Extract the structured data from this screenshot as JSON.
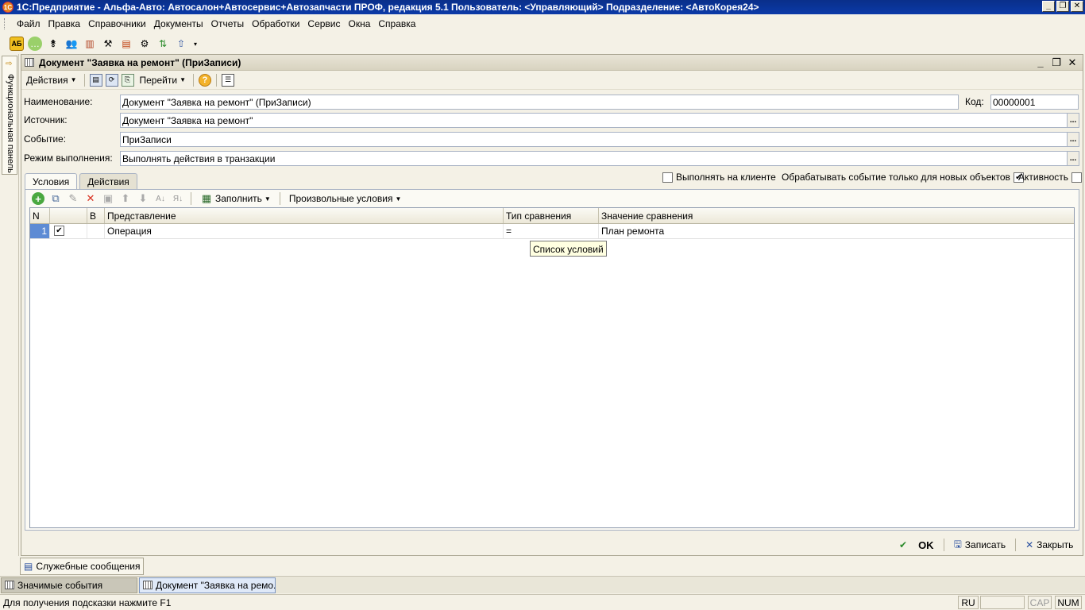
{
  "window": {
    "title": "1С:Предприятие - Альфа-Авто: Автосалон+Автосервис+Автозапчасти ПРОФ, редакция 5.1    Пользователь: <Управляющий>    Подразделение: <АвтоКорея24>",
    "app_icon": "1С"
  },
  "menu": [
    "Файл",
    "Правка",
    "Справочники",
    "Документы",
    "Отчеты",
    "Обработки",
    "Сервис",
    "Окна",
    "Справка"
  ],
  "side_panel": {
    "label": "Функциональная панель"
  },
  "document": {
    "title": "Документ \"Заявка на ремонт\" (ПриЗаписи)",
    "toolbar": {
      "actions": "Действия",
      "goto": "Перейти",
      "help": "?"
    },
    "fields": {
      "name_label": "Наименование:",
      "name_value": "Документ \"Заявка на ремонт\" (ПриЗаписи)",
      "code_label": "Код:",
      "code_value": "00000001",
      "source_label": "Источник:",
      "source_value": "Документ \"Заявка на ремонт\"",
      "event_label": "Событие:",
      "event_value": "ПриЗаписи",
      "mode_label": "Режим выполнения:",
      "mode_value": "Выполнять действия в транзакции",
      "ellipsis": "..."
    },
    "tabs": [
      "Условия",
      "Действия"
    ],
    "checks": {
      "client": {
        "label": "Выполнять на клиенте",
        "checked": false
      },
      "new_only": {
        "label": "Обрабатывать событие только для новых объектов",
        "checked": true
      },
      "active": {
        "label": "Активность",
        "checked": false
      }
    },
    "grid_toolbar": {
      "fill": "Заполнить",
      "custom": "Произвольные условия"
    },
    "grid": {
      "columns": [
        "N",
        "",
        "В",
        "Представление",
        "Тип сравнения",
        "Значение сравнения"
      ],
      "rows": [
        {
          "n": "1",
          "check": "✔",
          "b": "",
          "view": "Операция",
          "type": "=",
          "value": "План ремонта"
        }
      ]
    },
    "tooltip": "Список условий"
  },
  "bottom_buttons": {
    "ok": "OK",
    "save": "Записать",
    "close": "Закрыть"
  },
  "messages_tab": "Служебные сообщения",
  "taskbar": [
    "Значимые события",
    "Документ \"Заявка на ремо..."
  ],
  "status": {
    "hint": "Для получения подсказки нажмите F1",
    "lang": "RU",
    "cap": "CAP",
    "num": "NUM"
  }
}
